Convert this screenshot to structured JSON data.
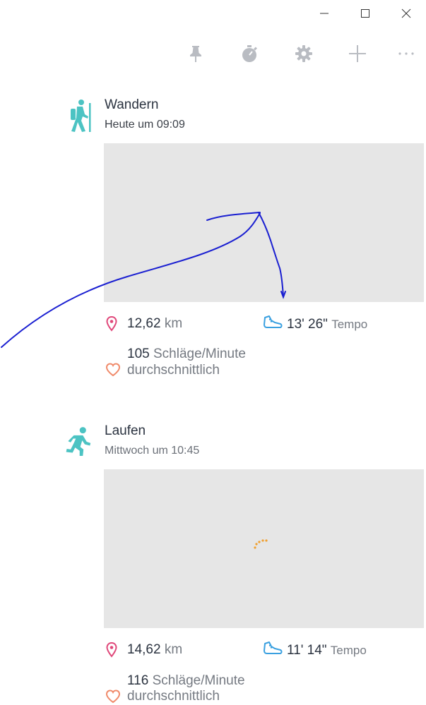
{
  "window": {
    "controls": {
      "minimize": "minimize",
      "maximize": "maximize",
      "close": "close"
    }
  },
  "toolbar": {
    "icons": [
      "pin-icon",
      "stopwatch-icon",
      "gear-icon",
      "plus-icon",
      "more-icon"
    ],
    "icon_color": "#b9bcc2"
  },
  "colors": {
    "accent_teal": "#4cc3c3",
    "location_pink": "#e0487a",
    "shoe_blue": "#3aa0e0",
    "heart": "#f08a6a",
    "annotation": "#1a1fd1",
    "loader": "#f0a030",
    "map_bg": "#e6e6e6"
  },
  "activities": [
    {
      "icon": "hiking-icon",
      "title": "Wandern",
      "subtitle": "Heute um 09:09",
      "distance_value": "12,62",
      "distance_unit": "km",
      "pace_value": "13' 26\"",
      "pace_unit": "Tempo",
      "heart_value": "105",
      "heart_unit": "Schläge/Minute",
      "heart_note": "durchschnittlich"
    },
    {
      "icon": "running-icon",
      "title": "Laufen",
      "subtitle": "Mittwoch um 10:45",
      "distance_value": "14,62",
      "distance_unit": "km",
      "pace_value": "11' 14\"",
      "pace_unit": "Tempo",
      "heart_value": "116",
      "heart_unit": "Schläge/Minute",
      "heart_note": "durchschnittlich"
    }
  ]
}
